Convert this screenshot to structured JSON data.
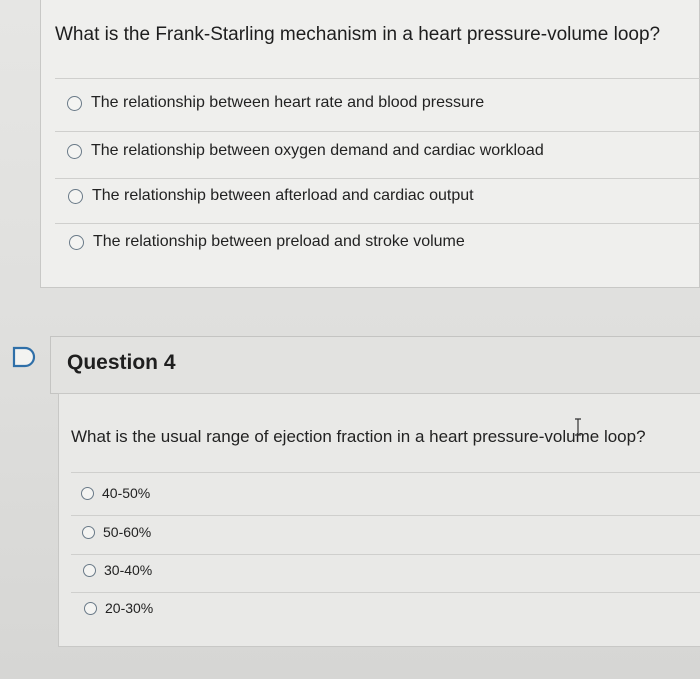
{
  "question3": {
    "prompt": "What is the Frank-Starling mechanism in a heart pressure-volume loop?",
    "options": [
      "The relationship between heart rate and blood pressure",
      "The relationship between oxygen demand and cardiac workload",
      "The relationship between afterload and cardiac output",
      "The relationship between preload and stroke volume"
    ]
  },
  "question4": {
    "title": "Question 4",
    "prompt": "What is the usual range of ejection fraction in a heart pressure-volume loop?",
    "options": [
      "40-50%",
      "50-60%",
      "30-40%",
      "20-30%"
    ]
  },
  "icons": {
    "flag": "flag-icon",
    "radio": "radio-button-icon",
    "cursor": "text-cursor-icon"
  },
  "colors": {
    "background": "#dfdfdd",
    "card": "#efefed",
    "radio_border": "#6a7a88"
  }
}
